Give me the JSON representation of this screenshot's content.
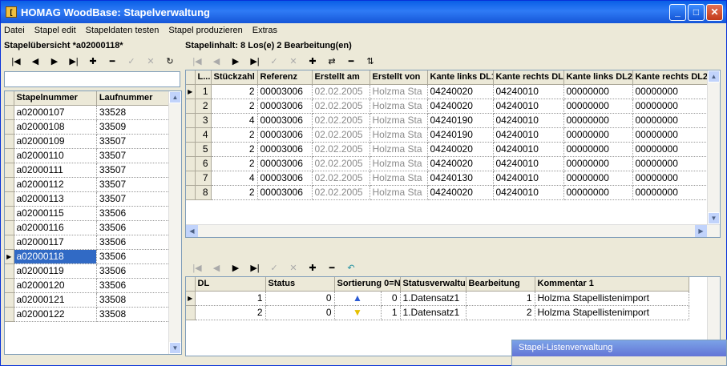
{
  "window": {
    "title": "HOMAG WoodBase: Stapelverwaltung",
    "icon_char": "["
  },
  "menu": [
    "Datei",
    "Stapel edit",
    "Stapeldaten testen",
    "Stapel produzieren",
    "Extras"
  ],
  "left": {
    "title": "Stapelübersicht *a02000118*",
    "headers": [
      "Stapelnummer",
      "Laufnummer"
    ],
    "rows": [
      [
        "a02000107",
        "33528"
      ],
      [
        "a02000108",
        "33509"
      ],
      [
        "a02000109",
        "33507"
      ],
      [
        "a02000110",
        "33507"
      ],
      [
        "a02000111",
        "33507"
      ],
      [
        "a02000112",
        "33507"
      ],
      [
        "a02000113",
        "33507"
      ],
      [
        "a02000115",
        "33506"
      ],
      [
        "a02000116",
        "33506"
      ],
      [
        "a02000117",
        "33506"
      ],
      [
        "a02000118",
        "33506"
      ],
      [
        "a02000119",
        "33506"
      ],
      [
        "a02000120",
        "33506"
      ],
      [
        "a02000121",
        "33508"
      ],
      [
        "a02000122",
        "33508"
      ]
    ],
    "selected_index": 10
  },
  "top": {
    "title": "Stapelinhalt: 8 Los(e)  2 Bearbeitung(en)",
    "headers": [
      "L...",
      "Stückzahl",
      "Referenz",
      "Erstellt am",
      "Erstellt von",
      "Kante links DL1",
      "Kante rechts DL1",
      "Kante links DL2",
      "Kante rechts DL2"
    ],
    "rows": [
      [
        "1",
        "2",
        "00003006",
        "02.02.2005",
        "Holzma Sta",
        "04240020",
        "04240010",
        "00000000",
        "00000000"
      ],
      [
        "2",
        "2",
        "00003006",
        "02.02.2005",
        "Holzma Sta",
        "04240020",
        "04240010",
        "00000000",
        "00000000"
      ],
      [
        "3",
        "4",
        "00003006",
        "02.02.2005",
        "Holzma Sta",
        "04240190",
        "04240010",
        "00000000",
        "00000000"
      ],
      [
        "4",
        "2",
        "00003006",
        "02.02.2005",
        "Holzma Sta",
        "04240190",
        "04240010",
        "00000000",
        "00000000"
      ],
      [
        "5",
        "2",
        "00003006",
        "02.02.2005",
        "Holzma Sta",
        "04240020",
        "04240010",
        "00000000",
        "00000000"
      ],
      [
        "6",
        "2",
        "00003006",
        "02.02.2005",
        "Holzma Sta",
        "04240020",
        "04240010",
        "00000000",
        "00000000"
      ],
      [
        "7",
        "4",
        "00003006",
        "02.02.2005",
        "Holzma Sta",
        "04240130",
        "04240010",
        "00000000",
        "00000000"
      ],
      [
        "8",
        "2",
        "00003006",
        "02.02.2005",
        "Holzma Sta",
        "04240020",
        "04240010",
        "00000000",
        "00000000"
      ]
    ]
  },
  "bottom": {
    "headers": [
      "DL",
      "Status",
      "Sortierung 0=N...",
      "Statusverwaltu...",
      "Bearbeitung",
      "Kommentar 1"
    ],
    "rows": [
      [
        "1",
        "0",
        "up",
        "0",
        "1.Datensatz1",
        "1",
        "Holzma Stapellistenimport"
      ],
      [
        "2",
        "0",
        "down",
        "1",
        "1.Datensatz1",
        "2",
        "Holzma Stapellistenimport"
      ]
    ]
  },
  "popup": {
    "title": "Stapel-Listenverwaltung"
  }
}
